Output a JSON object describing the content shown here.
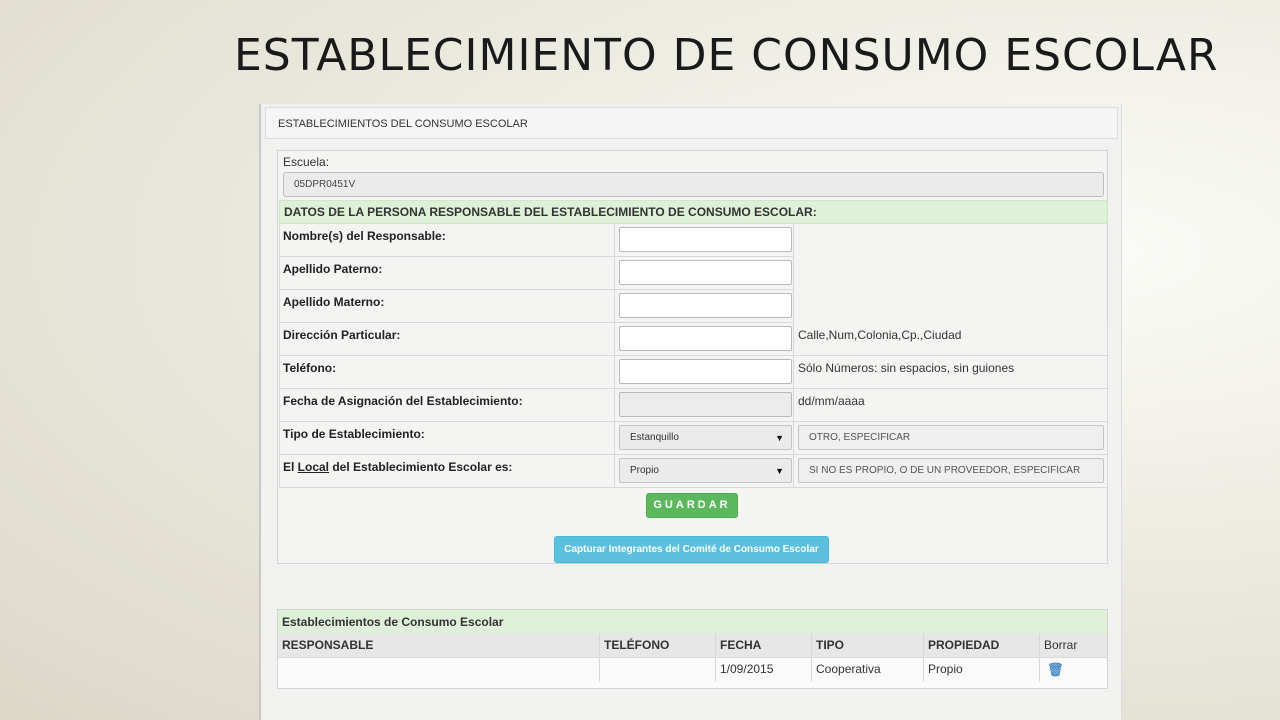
{
  "slide": {
    "title": "ESTABLECIMIENTO DE CONSUMO ESCOLAR"
  },
  "panel": {
    "header": "ESTABLECIMIENTOS DEL CONSUMO ESCOLAR"
  },
  "escuela": {
    "label": "Escuela:",
    "value": "05DPR0451V"
  },
  "form": {
    "section_title": "DATOS DE LA PERSONA RESPONSABLE DEL ESTABLECIMIENTO DE CONSUMO ESCOLAR:",
    "nombre_label": "Nombre(s) del Responsable:",
    "paterno_label": "Apellido Paterno:",
    "materno_label": "Apellido Materno:",
    "direccion_label": "Dirección Particular:",
    "direccion_hint": "Calle,Num,Colonia,Cp.,Ciudad",
    "telefono_label": "Teléfono:",
    "telefono_hint": "Sólo Números: sin espacios, sin guiones",
    "fecha_label": "Fecha de Asignación del Establecimiento:",
    "fecha_hint": "dd/mm/aaaa",
    "tipo_label": "Tipo de Establecimiento:",
    "tipo_selected": "Estanquillo",
    "tipo_other_placeholder": "OTRO, ESPECIFICAR",
    "local_label_prefix": "El ",
    "local_label_link": "Local",
    "local_label_suffix": " del Establecimiento Escolar es:",
    "local_selected": "Propio",
    "local_other_placeholder": "SI NO ES PROPIO, O DE UN PROVEEDOR, ESPECIFICAR",
    "select_arrow": "▼",
    "guardar_label": "GUARDAR",
    "capturar_label": "Capturar Integrantes del Comité de Consumo Escolar"
  },
  "table": {
    "title": "Establecimientos de Consumo Escolar",
    "headers": [
      "RESPONSABLE",
      "TELÉFONO",
      "FECHA",
      "TIPO",
      "PROPIEDAD",
      "Borrar"
    ],
    "rows": [
      {
        "responsable": "",
        "telefono": "",
        "fecha": "1/09/2015",
        "tipo": "Cooperativa",
        "propiedad": "Propio"
      }
    ]
  },
  "icons": {
    "delete": "trash-icon"
  },
  "colors": {
    "success": "#5cb85c",
    "info": "#5bc0de",
    "section_bg": "#dff0d8"
  }
}
